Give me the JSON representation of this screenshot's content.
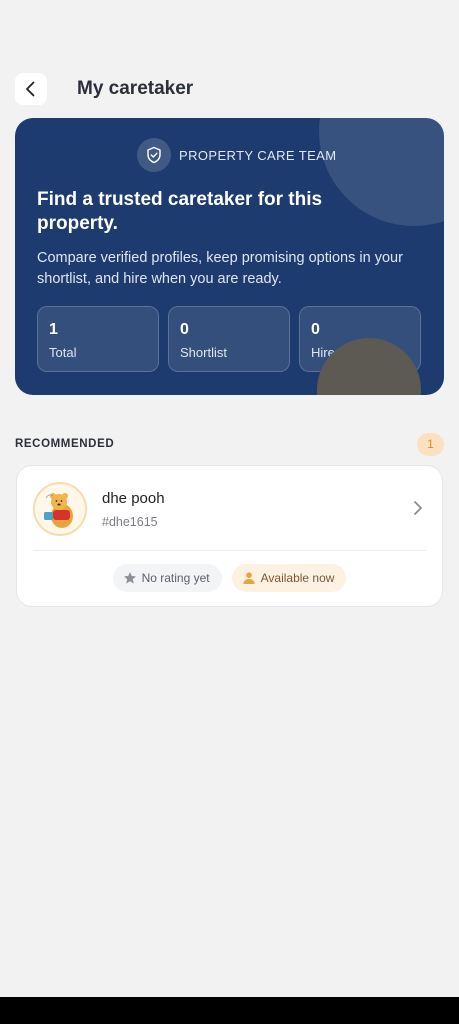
{
  "header": {
    "title": "My caretaker",
    "back_icon": "chevron-left-icon"
  },
  "hero": {
    "brand_icon": "shield-check-icon",
    "brand_label": "PROPERTY CARE TEAM",
    "title": "Find a trusted caretaker for this property.",
    "description": "Compare verified profiles, keep promising options in your shortlist, and hire when you are ready.",
    "stats": [
      {
        "value": "1",
        "label": "Total"
      },
      {
        "value": "0",
        "label": "Shortlist"
      },
      {
        "value": "0",
        "label": "Hired"
      }
    ],
    "background_color": "#1d3b6e"
  },
  "recommended": {
    "title": "RECOMMENDED",
    "count": "1",
    "items": [
      {
        "name": "dhe pooh",
        "handle": "#dhe1615",
        "avatar": "winnie-the-pooh-avatar",
        "rating_text": "No rating yet",
        "rating_icon": "star-icon",
        "availability_text": "Available now",
        "availability_icon": "person-icon",
        "chevron_icon": "chevron-right-icon"
      }
    ]
  },
  "colors": {
    "accent": "#e8a33a",
    "background": "#f2f2f2"
  }
}
